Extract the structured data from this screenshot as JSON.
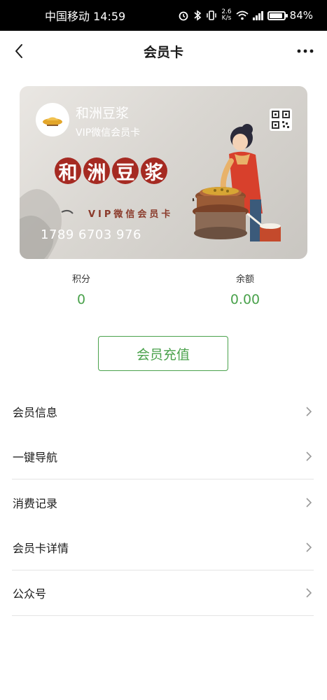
{
  "status_bar": {
    "carrier_time": "中国移动 14:59",
    "net_speed_value": "2.6",
    "net_speed_unit": "K/s",
    "network_type": "4G",
    "battery_level": 0.84,
    "battery_percent": "84%",
    "icons": [
      "alarm-icon",
      "bluetooth-icon",
      "vibrate-icon",
      "wifi-icon",
      "signal-icon",
      "battery-icon"
    ]
  },
  "nav": {
    "title": "会员卡",
    "back_icon": "chevron-left-icon",
    "more_icon": "more-icon"
  },
  "card": {
    "name": "和洲豆浆",
    "type": "VIP微信会员卡",
    "big_title_chars": [
      "和",
      "洲",
      "豆",
      "浆"
    ],
    "subtitle": "VIP微信会员卡",
    "number": "1789 6703 976",
    "colors": {
      "seal_red": "#a52a22",
      "apron": "#d8402c"
    }
  },
  "stats": {
    "points_label": "积分",
    "points_value": "0",
    "balance_label": "余额",
    "balance_value": "0.00"
  },
  "recharge": {
    "label": "会员充值"
  },
  "menu": {
    "items": [
      {
        "label": "会员信息"
      },
      {
        "label": "一键导航"
      },
      {
        "label": "消费记录"
      },
      {
        "label": "会员卡详情"
      },
      {
        "label": "公众号"
      }
    ]
  },
  "colors": {
    "accent": "#4aa24c",
    "divider": "#e4e4e4"
  }
}
